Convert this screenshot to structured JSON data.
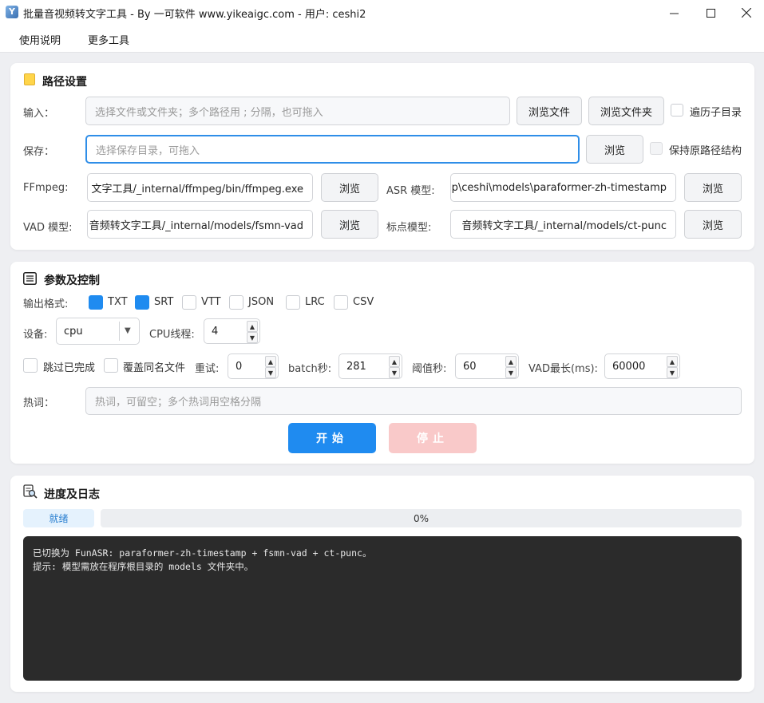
{
  "window": {
    "title": "批量音视频转文字工具 - By 一可软件 www.yikeaigc.com - 用户: ceshi2",
    "app_icon_glyph": "Y"
  },
  "menu": [
    "使用说明",
    "更多工具"
  ],
  "path_section": {
    "title": "路径设置",
    "input_label": "输入：",
    "input_placeholder": "选择文件或文件夹；多个路径用 ; 分隔，也可拖入",
    "browse_file": "浏览文件",
    "browse_folder": "浏览文件夹",
    "recursive_label": "遍历子目录",
    "save_label": "保存：",
    "save_placeholder": "选择保存目录，可拖入",
    "browse": "浏览",
    "keep_structure_label": "保持原路径结构",
    "ffmpeg_label": "FFmpeg:",
    "ffmpeg_value": "文字工具/_internal/ffmpeg/bin/ffmpeg.exe",
    "asr_label": "ASR 模型:",
    "asr_value": "p\\ceshi\\models\\paraformer-zh-timestamp",
    "vad_label": "VAD 模型:",
    "vad_value": "音频转文字工具/_internal/models/fsmn-vad",
    "punc_label": "标点模型:",
    "punc_value": "音频转文字工具/_internal/models/ct-punc"
  },
  "params_section": {
    "title": "参数及控制",
    "output_format_label": "输出格式:",
    "formats": [
      {
        "label": "TXT",
        "checked": true
      },
      {
        "label": "SRT",
        "checked": true
      },
      {
        "label": "VTT",
        "checked": false
      },
      {
        "label": "JSON",
        "checked": false
      },
      {
        "label": "LRC",
        "checked": false
      },
      {
        "label": "CSV",
        "checked": false
      }
    ],
    "device_label": "设备:",
    "device_value": "cpu",
    "cpu_threads_label": "CPU线程:",
    "cpu_threads_value": "4",
    "skip_done_label": "跳过已完成",
    "overwrite_label": "覆盖同名文件",
    "retry_label": "重试:",
    "retry_value": "0",
    "batch_label": "batch秒:",
    "batch_value": "281",
    "threshold_label": "阈值秒:",
    "threshold_value": "60",
    "vad_max_label": "VAD最长(ms):",
    "vad_max_value": "60000",
    "hotword_label": "热词：",
    "hotword_placeholder": "热词，可留空；多个热词用空格分隔",
    "start_label": "开始",
    "stop_label": "停止"
  },
  "log_section": {
    "title": "进度及日志",
    "status": "就绪",
    "progress_text": "0%",
    "progress_percent": 0,
    "log_lines": [
      "已切换为 FunASR: paraformer-zh-timestamp + fsmn-vad + ct-punc。",
      "提示: 模型需放在程序根目录的 models 文件夹中。"
    ]
  },
  "colors": {
    "accent": "#1f8bf0",
    "stop_disabled": "#f9c9c9",
    "log_bg": "#2b2b2b"
  }
}
